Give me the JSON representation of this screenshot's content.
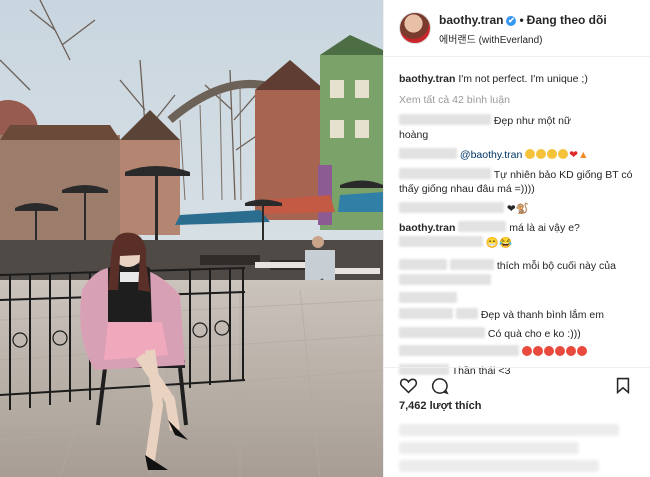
{
  "header": {
    "username": "baothy.tran",
    "verified_mark": "✔",
    "separator": "•",
    "follow_label": "Đang theo dõi",
    "location": "에버랜드 (withEverland)"
  },
  "caption": {
    "username": "baothy.tran",
    "text": "I'm not perfect. I'm unique ;)"
  },
  "view_all_comments": "Xem tất cả 42 bình luận",
  "comments": [
    {
      "text": "Đẹp như một nữ",
      "text2": "hoàng"
    },
    {
      "mention": "@baothy.tran"
    },
    {
      "text": "Tự nhiên bảo KD giống BT có",
      "text2": "thấy giống nhau đâu má =))))"
    },
    {
      "emoji_text": "❤🐒"
    },
    {
      "username": "baothy.tran",
      "text": "má là ai vậy e?"
    },
    {
      "emoji_text": "😁😂"
    },
    {
      "text": "thích mỗi bộ cuối này của"
    },
    {
      "text": "Đẹp và thanh bình lắm em"
    },
    {
      "text": "Có quà cho e ko :)))"
    },
    {
      "text": "Thần thái <3"
    }
  ],
  "actions": {
    "like_icon": "heart-outline-icon",
    "comment_icon": "comment-bubble-icon",
    "save_icon": "bookmark-icon"
  },
  "likes_text": "7,462 lượt thích",
  "colors": {
    "link": "#003569",
    "verified": "#3897f0",
    "border": "#efefef"
  }
}
